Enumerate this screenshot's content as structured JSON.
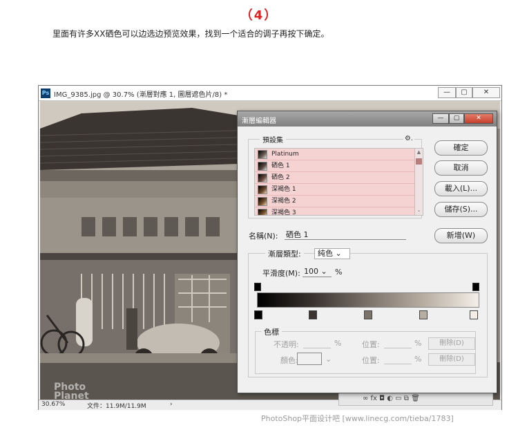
{
  "step": {
    "title": "（4）"
  },
  "instruction": "里面有许多XX硒色可以边选边预览效果，找到一个适合的调子再按下确定。",
  "doc_window": {
    "app_icon": "Ps",
    "title": "IMG_9385.jpg @ 30.7% (漸層對應 1, 圖層遮色片/8) *",
    "buttons": {
      "minimize": "—",
      "maximize": "▢",
      "close": "✕"
    },
    "status": {
      "zoom": "30.67%",
      "file": "文件：11.9M/11.9M",
      "arrow": "›"
    },
    "watermark": {
      "line1": "Photo",
      "line2": "Planet"
    }
  },
  "dialog": {
    "title": "漸層編輯器",
    "buttons": {
      "minimize": "—",
      "maximize": "▢",
      "close": "✕"
    },
    "presets": {
      "label": "預設集",
      "gear": "⚙.",
      "items": [
        "Platinum",
        "硒色 1",
        "硒色 2",
        "深褐色 1",
        "深褐色 2",
        "深褐色 3"
      ],
      "scroll_up": "▲",
      "scroll_down": "⌄"
    },
    "side_buttons": {
      "ok": "確定",
      "cancel": "取消",
      "load": "載入(L)...",
      "save": "儲存(S)...",
      "new": "新增(W)"
    },
    "name": {
      "label": "名稱(N):",
      "value": "硒色 1"
    },
    "gradient_type": {
      "label": "漸層類型:",
      "value": "純色 ⌄"
    },
    "smoothness": {
      "label": "平滑度(M):",
      "value": "100 ⌄",
      "unit": "%"
    },
    "color_stops": {
      "label": "色標",
      "opacity_label": "不透明:",
      "opacity_unit": "%",
      "location_label1": "位置:",
      "location_unit1": "%",
      "delete1": "刪除(D)",
      "color_label": "顏色:",
      "location_label2": "位置:",
      "location_unit2": "%",
      "delete2": "刪除(D)"
    }
  },
  "panel_icons": "∞  fx  ◘  ◐  ▭  ⧉  🗑",
  "footer_watermark": "PhotoShop平面设计吧  [www.linecg.com/tieba/1783]"
}
